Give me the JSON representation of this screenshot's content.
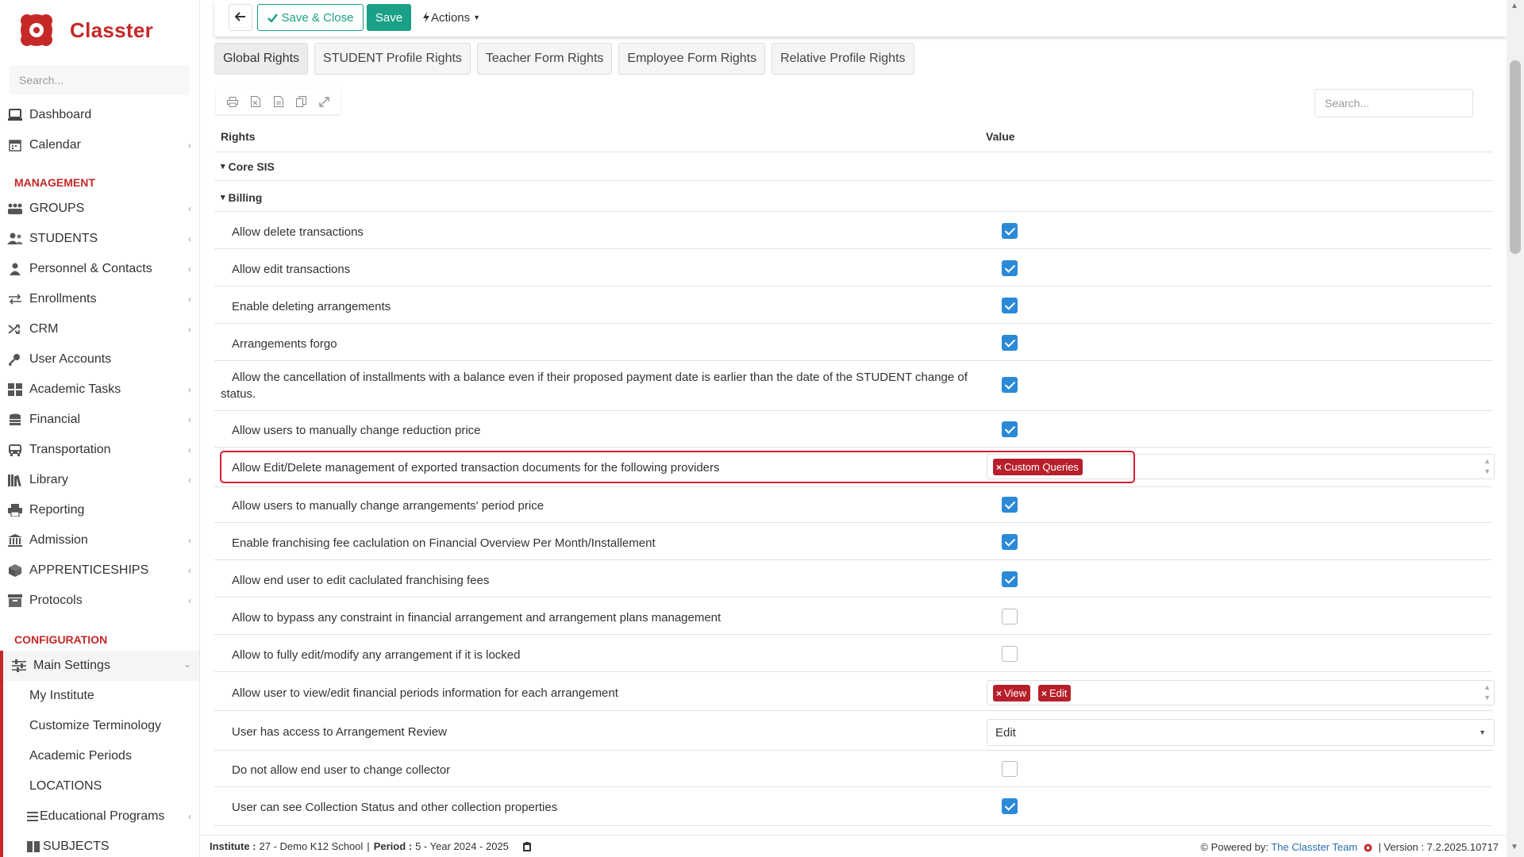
{
  "app": {
    "name": "Classter",
    "brand_color": "#c62828",
    "accent_color": "#1aa086",
    "checkbox_color": "#2b8ad8",
    "tag_color": "#b7202b"
  },
  "sidebar": {
    "search_placeholder": "Search...",
    "items_top": [
      {
        "label": "Dashboard",
        "icon": "laptop-icon",
        "chevron": false
      },
      {
        "label": "Calendar",
        "icon": "calendar-icon",
        "chevron": true
      }
    ],
    "management_title": "MANAGEMENT",
    "management_items": [
      {
        "label": "GROUPS",
        "icon": "groups-icon",
        "chevron": true
      },
      {
        "label": "STUDENTS",
        "icon": "students-icon",
        "chevron": true
      },
      {
        "label": "Personnel & Contacts",
        "icon": "person-icon",
        "chevron": true
      },
      {
        "label": "Enrollments",
        "icon": "exchange-icon",
        "chevron": true
      },
      {
        "label": "CRM",
        "icon": "shuffle-icon",
        "chevron": true
      },
      {
        "label": "User Accounts",
        "icon": "key-icon",
        "chevron": false
      },
      {
        "label": "Academic Tasks",
        "icon": "grid-icon",
        "chevron": true
      },
      {
        "label": "Financial",
        "icon": "coins-icon",
        "chevron": true
      },
      {
        "label": "Transportation",
        "icon": "bus-icon",
        "chevron": true
      },
      {
        "label": "Library",
        "icon": "books-icon",
        "chevron": true
      },
      {
        "label": "Reporting",
        "icon": "printer-icon",
        "chevron": false
      },
      {
        "label": "Admission",
        "icon": "institution-icon",
        "chevron": true
      },
      {
        "label": "APPRENTICESHIPS",
        "icon": "box-icon",
        "chevron": true
      },
      {
        "label": "Protocols",
        "icon": "archive-icon",
        "chevron": true
      }
    ],
    "configuration_title": "CONFIGURATION",
    "main_settings_label": "Main Settings",
    "sub_items": [
      {
        "label": "My Institute"
      },
      {
        "label": "Customize Terminology"
      },
      {
        "label": "Academic Periods"
      },
      {
        "label": "LOCATIONS"
      },
      {
        "label": "Educational Programs"
      },
      {
        "label": "SUBJECTS"
      }
    ]
  },
  "toolbar": {
    "back_icon": "arrow-left-icon",
    "save_close_label": "Save & Close",
    "save_label": "Save",
    "actions_label": "Actions"
  },
  "tabs": [
    {
      "label": "Global Rights",
      "active": true
    },
    {
      "label": "STUDENT Profile Rights",
      "active": false
    },
    {
      "label": "Teacher Form Rights",
      "active": false
    },
    {
      "label": "Employee Form Rights",
      "active": false
    },
    {
      "label": "Relative Profile Rights",
      "active": false
    }
  ],
  "table": {
    "search_placeholder": "Search...",
    "col_rights": "Rights",
    "col_value": "Value",
    "groups": [
      {
        "label": "Core SIS"
      },
      {
        "label": "Billing"
      }
    ],
    "rows": [
      {
        "label": "Allow delete transactions",
        "type": "checkbox",
        "checked": true
      },
      {
        "label": "Allow edit transactions",
        "type": "checkbox",
        "checked": true
      },
      {
        "label": "Enable deleting arrangements",
        "type": "checkbox",
        "checked": true
      },
      {
        "label": "Arrangements forgo",
        "type": "checkbox",
        "checked": true
      },
      {
        "label": "Allow the cancellation of installments with a balance even if their proposed payment date is earlier than the date of the STUDENT change of status.",
        "type": "checkbox",
        "checked": true
      },
      {
        "label": "Allow users to manually change reduction price",
        "type": "checkbox",
        "checked": true
      },
      {
        "label": "Allow Edit/Delete management of exported transaction documents for the following providers",
        "type": "tags",
        "tags": [
          "Custom Queries"
        ]
      },
      {
        "label": "Allow users to manually change arrangements' period price",
        "type": "checkbox",
        "checked": true
      },
      {
        "label": "Enable franchising fee caclulation on Financial Overview Per Month/Installement",
        "type": "checkbox",
        "checked": true
      },
      {
        "label": "Allow end user to edit caclulated franchising fees",
        "type": "checkbox",
        "checked": true
      },
      {
        "label": "Allow to bypass any constraint in financial arrangement and arrangement plans management",
        "type": "checkbox",
        "checked": false
      },
      {
        "label": "Allow to fully edit/modify any arrangement if it is locked",
        "type": "checkbox",
        "checked": false
      },
      {
        "label": "Allow user to view/edit financial periods information for each arrangement",
        "type": "tags",
        "tags": [
          "View",
          "Edit"
        ]
      },
      {
        "label": "User has access to Arrangement Review",
        "type": "select",
        "value": "Edit"
      },
      {
        "label": "Do not allow end user to change collector",
        "type": "checkbox",
        "checked": false
      },
      {
        "label": "User can see Collection Status and other collection properties",
        "type": "checkbox",
        "checked": true
      }
    ]
  },
  "footer": {
    "institute_label": "Institute :",
    "institute_value": "27 - Demo K12 School",
    "separator": "|",
    "period_label": "Period :",
    "period_value": "5 - Year 2024 - 2025",
    "powered_by": "Powered by:",
    "team": "The Classter Team",
    "version": "| Version : 7.2.2025.10717"
  }
}
